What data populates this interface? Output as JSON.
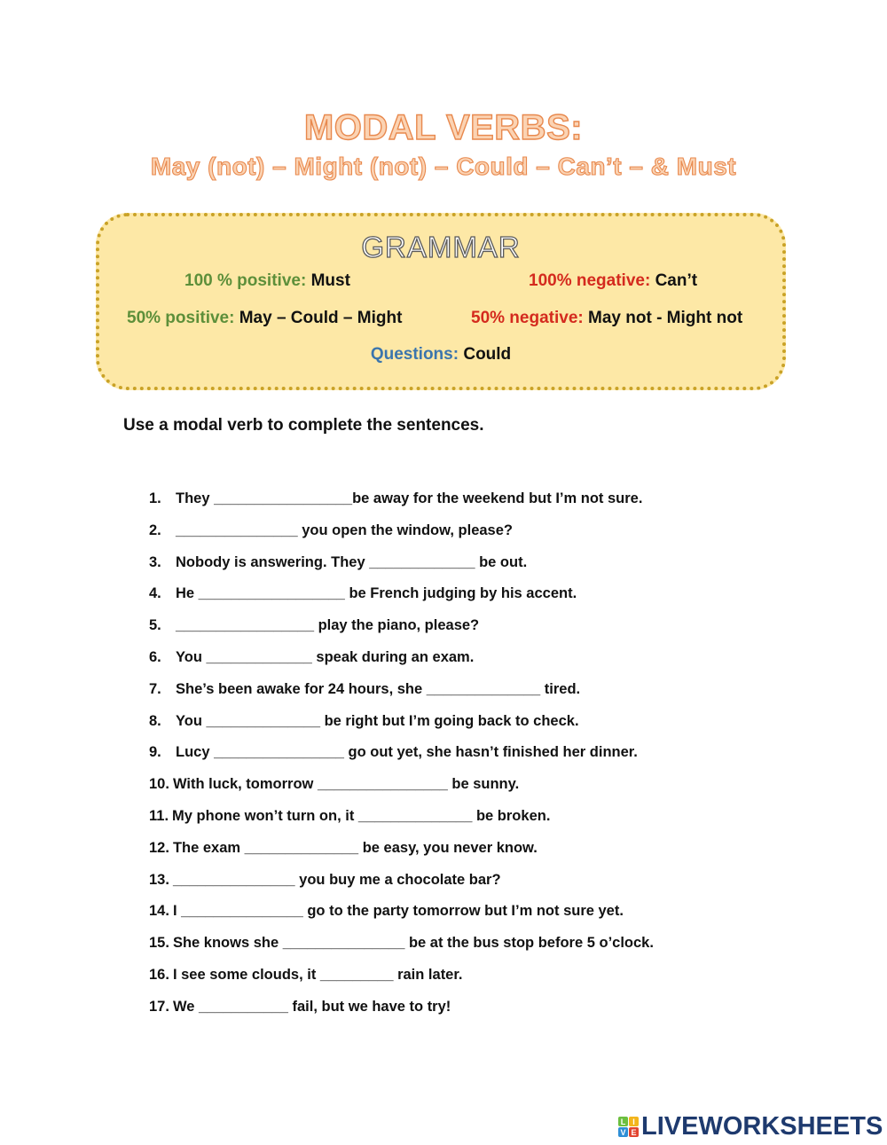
{
  "header": {
    "title": "MODAL VERBS:",
    "subtitle": "May (not) – Might (not) – Could – Can’t – & Must"
  },
  "grammar": {
    "title": "GRAMMAR",
    "rules": [
      {
        "label": "100 % positive:",
        "value": "Must",
        "tone": "positive"
      },
      {
        "label": "100% negative:",
        "value": "Can’t",
        "tone": "negative"
      },
      {
        "label": "50% positive:",
        "value": "May – Could – Might",
        "tone": "positive"
      },
      {
        "label": "50% negative:",
        "value": "May not - Might not",
        "tone": "negative"
      },
      {
        "label": "Questions:",
        "value": "Could",
        "tone": "question"
      }
    ],
    "colors": {
      "positive": "#5d8f3a",
      "negative": "#d42a1e",
      "question": "#3b75ad",
      "box_fill": "#fde8a6",
      "box_border": "#c9a227"
    }
  },
  "instruction": "Use a modal verb to complete the sentences.",
  "exercises": [
    {
      "num": "1.",
      "text": "They _________________be away for the weekend but I’m not sure."
    },
    {
      "num": "2.",
      "text": "_______________ you open the window, please?"
    },
    {
      "num": "3.",
      "text": "Nobody is answering. They _____________ be out."
    },
    {
      "num": "4.",
      "text": "He __________________ be French judging by his accent."
    },
    {
      "num": "5.",
      "text": "_________________ play the piano, please?"
    },
    {
      "num": "6.",
      "text": "You _____________ speak during an exam."
    },
    {
      "num": "7.",
      "text": "She’s been awake for 24 hours, she ______________ tired."
    },
    {
      "num": "8.",
      "text": "You ______________ be right but I’m going back to check."
    },
    {
      "num": "9.",
      "text": "Lucy ________________ go out yet, she hasn’t finished her dinner."
    },
    {
      "num": "10.",
      "text": "With luck, tomorrow ________________ be sunny."
    },
    {
      "num": "11.",
      "text": "My phone won’t turn on, it ______________ be  broken."
    },
    {
      "num": "12.",
      "text": "The exam ______________ be easy, you never know."
    },
    {
      "num": "13.",
      "text": "_______________ you buy me a chocolate bar?"
    },
    {
      "num": "14.",
      "text": "I _______________ go to the party tomorrow but I’m not sure yet."
    },
    {
      "num": "15.",
      "text": "She knows she _______________ be at the bus stop before 5 o’clock."
    },
    {
      "num": "16.",
      "text": "I see some clouds, it _________ rain later."
    },
    {
      "num": "17.",
      "text": "We ___________ fail, but we have to try!"
    }
  ],
  "footer": {
    "logo_badge": [
      "L",
      "I",
      "V",
      "E"
    ],
    "logo_badge_colors": [
      "#6cbf3f",
      "#f3b51c",
      "#2f8fd6",
      "#e2442f"
    ],
    "logo_text": "LIVEWORKSHEETS"
  }
}
